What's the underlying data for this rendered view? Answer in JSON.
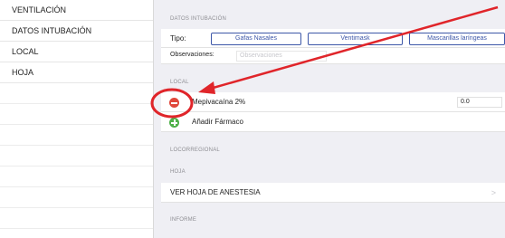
{
  "sidebar": {
    "items": [
      {
        "label": "VENTILACIÓN"
      },
      {
        "label": "DATOS INTUBACIÓN"
      },
      {
        "label": "LOCAL"
      },
      {
        "label": "HOJA"
      }
    ]
  },
  "main": {
    "datos_intubacion": {
      "header": "DATOS INTUBACIÓN",
      "tipo_label": "Tipo:",
      "tipo_options": [
        "Gafas Nasales",
        "Ventimask",
        "Mascarillas laríngeas"
      ],
      "observaciones_label": "Observaciones:",
      "observaciones_placeholder": "Observaciones"
    },
    "local": {
      "header": "LOCAL",
      "drug_name": "Mepivacaína 2%",
      "drug_value": "0.0",
      "add_label": "Añadir Fármaco"
    },
    "locorregional": {
      "header": "LOCORREGIONAL"
    },
    "hoja": {
      "header": "HOJA",
      "ver_label": "VER HOJA DE ANESTESIA",
      "chevron": ">"
    },
    "informe": {
      "header": "INFORME"
    }
  },
  "colors": {
    "accent": "#3d57a8",
    "delete": "#e0473b",
    "add": "#4fb04a",
    "annotation": "#e0252a"
  },
  "icons": [
    "delete-circle-icon",
    "add-circle-icon",
    "chevron-right-icon",
    "annotation-arrow",
    "annotation-circle"
  ]
}
